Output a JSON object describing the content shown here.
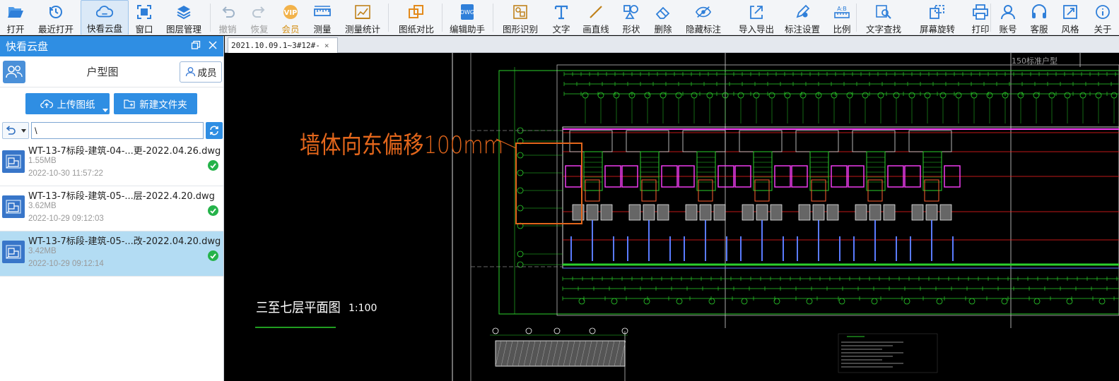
{
  "toolbar": {
    "items": [
      {
        "label": "打开",
        "icon": "folder-open-icon"
      },
      {
        "label": "最近打开",
        "icon": "history-icon"
      },
      {
        "label": "快看云盘",
        "icon": "cloud-icon"
      },
      {
        "label": "窗口",
        "icon": "window-icon"
      },
      {
        "label": "图层管理",
        "icon": "layers-icon"
      },
      {
        "label": "撤销",
        "icon": "undo-icon"
      },
      {
        "label": "恢复",
        "icon": "redo-icon"
      },
      {
        "label": "会员",
        "icon": "vip-icon"
      },
      {
        "label": "测量",
        "icon": "ruler-icon"
      },
      {
        "label": "测量统计",
        "icon": "measure-stats-icon"
      },
      {
        "label": "图纸对比",
        "icon": "compare-icon"
      },
      {
        "label": "编辑助手",
        "icon": "edit-helper-icon"
      },
      {
        "label": "图形识别",
        "icon": "shape-recognize-icon"
      },
      {
        "label": "文字",
        "icon": "text-icon"
      },
      {
        "label": "画直线",
        "icon": "line-icon"
      },
      {
        "label": "形状",
        "icon": "shapes-icon"
      },
      {
        "label": "删除",
        "icon": "eraser-icon"
      },
      {
        "label": "隐藏标注",
        "icon": "eye-hidden-icon"
      },
      {
        "label": "导入导出",
        "icon": "import-export-icon"
      },
      {
        "label": "标注设置",
        "icon": "annotation-settings-icon"
      },
      {
        "label": "比例",
        "icon": "scale-icon"
      },
      {
        "label": "文字查找",
        "icon": "text-search-icon"
      },
      {
        "label": "屏幕旋转",
        "icon": "rotate-screen-icon"
      },
      {
        "label": "打印",
        "icon": "printer-icon"
      },
      {
        "label": "账号",
        "icon": "account-icon"
      },
      {
        "label": "客服",
        "icon": "headset-icon"
      },
      {
        "label": "风格",
        "icon": "style-icon"
      },
      {
        "label": "关于",
        "icon": "about-icon"
      }
    ]
  },
  "panel": {
    "title": "快看云盘",
    "folder_name": "户型图",
    "member_label": "成员",
    "upload_label": "上传图纸",
    "new_folder_label": "新建文件夹",
    "path_value": "\\",
    "files": [
      {
        "name": "WT-13-7标段-建筑-04-...更-2022.04.26.dwg",
        "size": "1.55MB",
        "date": "2022-10-30 11:57:22",
        "selected": false
      },
      {
        "name": "WT-13-7标段-建筑-05-...层-2022.4.20.dwg",
        "size": "3.62MB",
        "date": "2022-10-29 09:12:03",
        "selected": false
      },
      {
        "name": "WT-13-7标段-建筑-05-...改-2022.04.20.dwg",
        "size": "3.42MB",
        "date": "2022-10-29 09:12:14",
        "selected": true
      }
    ]
  },
  "tab": {
    "label": "2021.10.09.1~3#12#-",
    "close": "×"
  },
  "drawing": {
    "annotation_text": "墙体向东偏移100mm",
    "floor_title": "三至七层平面图",
    "floor_scale": "1:100",
    "corner_label": "150标准户型",
    "annotation_color": "#e3661b"
  }
}
